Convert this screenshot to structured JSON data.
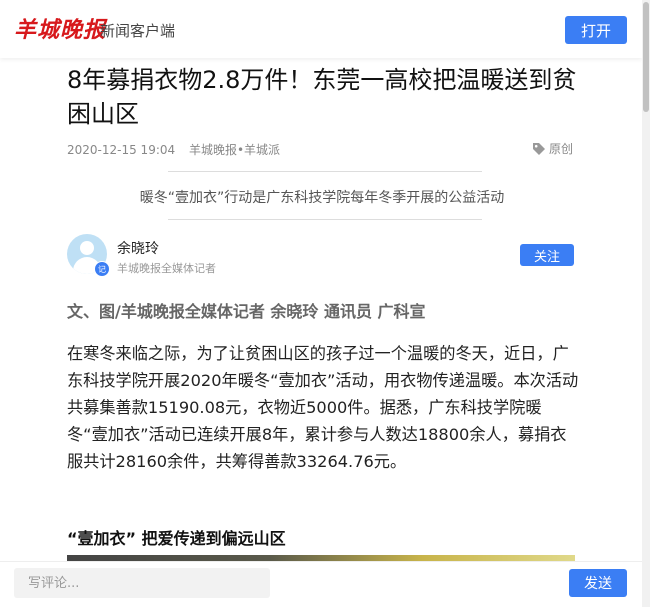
{
  "header": {
    "logo_text": "羊城晚报",
    "app_name": "新闻客户端",
    "open_label": "打开"
  },
  "article": {
    "title": "8年募捐衣物2.8万件！东莞一高校把温暖送到贫困山区",
    "date": "2020-12-15 19:04",
    "source": "羊城晚报•羊城派",
    "original_label": "原创",
    "summary": "暖冬“壹加衣”行动是广东科技学院每年冬季开展的公益活动",
    "author": {
      "name": "余晓玲",
      "role": "羊城晚报全媒体记者",
      "badge": "记",
      "follow_label": "关注"
    },
    "byline": "文、图/羊城晚报全媒体记者 余晓玲 通讯员 广科宣",
    "paragraph": "在寒冬来临之际，为了让贫困山区的孩子过一个温暖的冬天，近日，广东科技学院开展2020年暖冬“壹加衣”活动，用衣物传递温暖。本次活动共募集善款15190.08元，衣物近5000件。据悉，广东科技学院暖冬“壹加衣”活动已连续开展8年，累计参与人数达18800余人，募捐衣服共计28160余件，共筹得善款33264.76元。",
    "subheading": "“壹加衣” 把爱传递到偏远山区"
  },
  "footer": {
    "comment_placeholder": "写评论...",
    "send_label": "发送"
  },
  "colors": {
    "accent": "#3b7ef4",
    "logo_red": "#d7191c"
  }
}
